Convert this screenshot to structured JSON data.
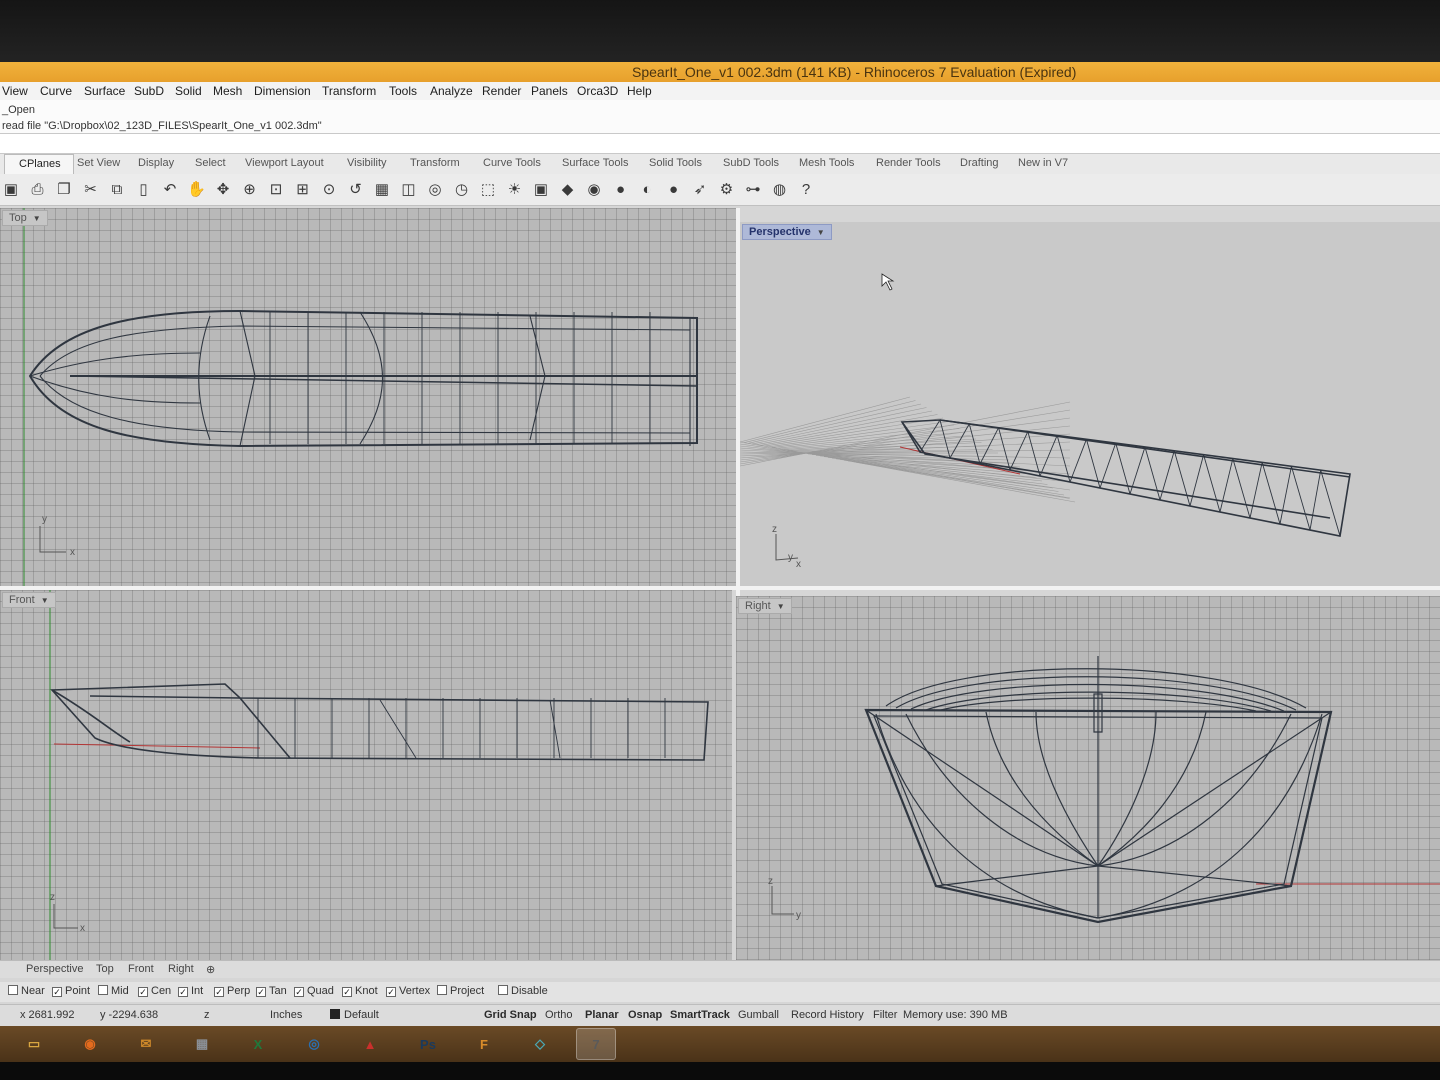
{
  "window": {
    "title": "SpearIt_One_v1 002.3dm (141 KB) - Rhinoceros 7 Evaluation (Expired)"
  },
  "menu": [
    "View",
    "Curve",
    "Surface",
    "SubD",
    "Solid",
    "Mesh",
    "Dimension",
    "Transform",
    "Tools",
    "Analyze",
    "Render",
    "Panels",
    "Orca3D",
    "Help"
  ],
  "command_history": [
    "_Open",
    "read file \"G:\\Dropbox\\02_123D_FILES\\SpearIt_One_v1 002.3dm\""
  ],
  "toolbar_tabs": [
    "CPlanes",
    "Set View",
    "Display",
    "Select",
    "Viewport Layout",
    "Visibility",
    "Transform",
    "Curve Tools",
    "Surface Tools",
    "Solid Tools",
    "SubD Tools",
    "Mesh Tools",
    "Render Tools",
    "Drafting",
    "New in V7"
  ],
  "toolbar_icons": [
    {
      "name": "save-icon",
      "glyph": "▣"
    },
    {
      "name": "print-icon",
      "glyph": "⎙"
    },
    {
      "name": "paste-icon",
      "glyph": "❐"
    },
    {
      "name": "cut-icon",
      "glyph": "✂"
    },
    {
      "name": "copy-icon",
      "glyph": "⧉"
    },
    {
      "name": "clipboard-icon",
      "glyph": "▯"
    },
    {
      "name": "undo-icon",
      "glyph": "↶"
    },
    {
      "name": "pan-hand-icon",
      "glyph": "✋"
    },
    {
      "name": "rotate-view-icon",
      "glyph": "✥"
    },
    {
      "name": "zoom-icon",
      "glyph": "⊕"
    },
    {
      "name": "zoom-window-icon",
      "glyph": "⊡"
    },
    {
      "name": "zoom-extents-icon",
      "glyph": "⊞"
    },
    {
      "name": "zoom-selected-icon",
      "glyph": "⊙"
    },
    {
      "name": "undo-view-icon",
      "glyph": "↺"
    },
    {
      "name": "four-viewports-icon",
      "glyph": "▦"
    },
    {
      "name": "named-view-icon",
      "glyph": "◫"
    },
    {
      "name": "camera-icon",
      "glyph": "◎"
    },
    {
      "name": "clock-icon",
      "glyph": "◷"
    },
    {
      "name": "select-icon",
      "glyph": "⬚"
    },
    {
      "name": "light-bulb-icon",
      "glyph": "☀"
    },
    {
      "name": "lock-icon",
      "glyph": "▣"
    },
    {
      "name": "layer-icon",
      "glyph": "◆"
    },
    {
      "name": "color-wheel-icon",
      "glyph": "◉"
    },
    {
      "name": "material-sphere-icon",
      "glyph": "●"
    },
    {
      "name": "render-sphere-icon",
      "glyph": "◐"
    },
    {
      "name": "blue-sphere-icon",
      "glyph": "●"
    },
    {
      "name": "arrow-tool-icon",
      "glyph": "➶"
    },
    {
      "name": "gear-icon",
      "glyph": "⚙"
    },
    {
      "name": "tree-icon",
      "glyph": "⊶"
    },
    {
      "name": "globe-icon",
      "glyph": "◍"
    },
    {
      "name": "help-icon",
      "glyph": "?"
    }
  ],
  "viewports": {
    "top": "Top",
    "perspective": "Perspective",
    "front": "Front",
    "right": "Right"
  },
  "viewport_tabs": [
    "Perspective",
    "Top",
    "Front",
    "Right"
  ],
  "osnaps": [
    {
      "label": "Near",
      "checked": false
    },
    {
      "label": "Point",
      "checked": true
    },
    {
      "label": "Mid",
      "checked": false
    },
    {
      "label": "Cen",
      "checked": true
    },
    {
      "label": "Int",
      "checked": true
    },
    {
      "label": "Perp",
      "checked": true
    },
    {
      "label": "Tan",
      "checked": true
    },
    {
      "label": "Quad",
      "checked": true
    },
    {
      "label": "Knot",
      "checked": true
    },
    {
      "label": "Vertex",
      "checked": true
    },
    {
      "label": "Project",
      "checked": false
    },
    {
      "label": "Disable",
      "checked": false
    }
  ],
  "status": {
    "x": "x 2681.992",
    "y": "y -2294.638",
    "z": "z",
    "units": "Inches",
    "layer": "Default",
    "grid_snap": "Grid Snap",
    "ortho": "Ortho",
    "planar": "Planar",
    "osnap": "Osnap",
    "smarttrack": "SmartTrack",
    "gumball": "Gumball",
    "record_history": "Record History",
    "filter": "Filter",
    "memory": "Memory use: 390 MB"
  },
  "taskbar": [
    {
      "name": "file-explorer-icon",
      "glyph": "▭",
      "color": "#d9a640"
    },
    {
      "name": "firefox-icon",
      "glyph": "◉",
      "color": "#e46b1e"
    },
    {
      "name": "outlook-icon",
      "glyph": "✉",
      "color": "#d08a2a"
    },
    {
      "name": "calculator-icon",
      "glyph": "▦",
      "color": "#8a8f96"
    },
    {
      "name": "excel-icon",
      "glyph": "X",
      "color": "#1f7a3c"
    },
    {
      "name": "maps-icon",
      "glyph": "◎",
      "color": "#2a6fb0"
    },
    {
      "name": "acrobat-icon",
      "glyph": "▲",
      "color": "#c9302c"
    },
    {
      "name": "photoshop-icon",
      "glyph": "Ps",
      "color": "#1b3a5c"
    },
    {
      "name": "fusion-icon",
      "glyph": "F",
      "color": "#d98c2a"
    },
    {
      "name": "notepad-icon",
      "glyph": "◇",
      "color": "#4aa8b5"
    },
    {
      "name": "rhino-icon",
      "glyph": "7",
      "color": "#5a5a5a"
    }
  ],
  "colors": {
    "title_bar": "#f1b23c",
    "perspective_label": "#aeb9d8",
    "hull_lines": "#2f3640",
    "x_axis": "#b33535"
  }
}
